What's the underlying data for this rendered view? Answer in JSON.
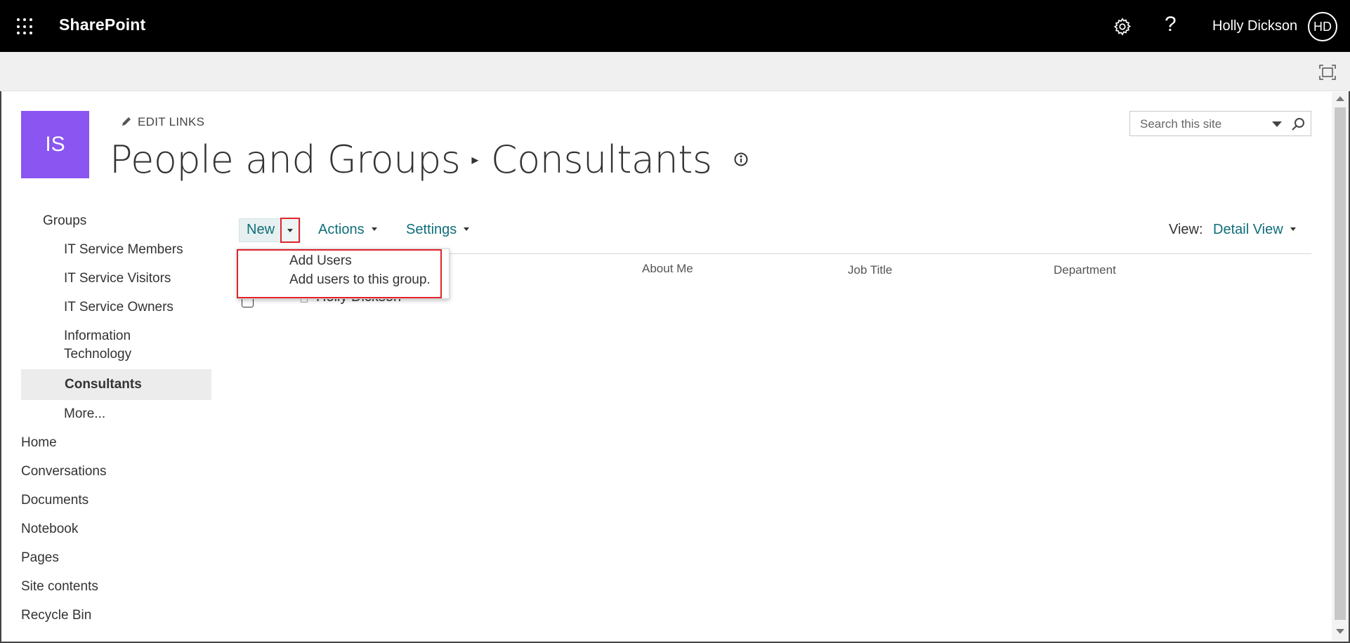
{
  "suite": {
    "brand": "SharePoint",
    "user_name": "Holly Dickson",
    "user_initials": "HD",
    "help_glyph": "?"
  },
  "site": {
    "logo_initials": "IS",
    "logo_color": "#8a55f0",
    "edit_links_label": "EDIT LINKS",
    "breadcrumb_parent": "People and Groups",
    "breadcrumb_current": "Consultants",
    "search_placeholder": "Search this site"
  },
  "nav": {
    "groups_label": "Groups",
    "group_items": [
      "IT Service Members",
      "IT Service Visitors",
      "IT Service Owners",
      "Information\nTechnology",
      "Consultants",
      "More..."
    ],
    "selected": "Consultants",
    "links": [
      "Home",
      "Conversations",
      "Documents",
      "Notebook",
      "Pages",
      "Site contents",
      "Recycle Bin"
    ]
  },
  "toolbar": {
    "new_label": "New",
    "actions_label": "Actions",
    "settings_label": "Settings",
    "view_label": "View:",
    "view_value": "Detail View"
  },
  "table": {
    "columns": [
      "About Me",
      "Job Title",
      "Department"
    ],
    "rows": [
      {
        "name": "Holly Dickson"
      }
    ]
  },
  "menu": {
    "item_title": "Add Users",
    "item_description": "Add users to this group."
  },
  "colors": {
    "accent": "#0f6e7a",
    "suitebar": "#000000",
    "highlight": "#e0242a"
  }
}
